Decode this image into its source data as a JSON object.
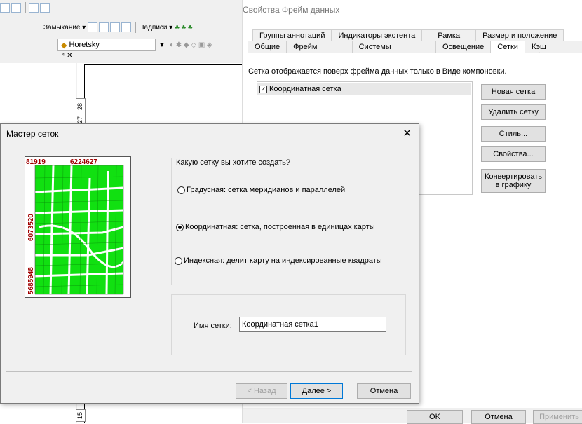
{
  "toolbar": {
    "snapping_label": "Замыкание ▾",
    "labels_label": "Надписи ▾",
    "layer_combo": "Horetsky",
    "pin_close": "⁴ ✕"
  },
  "rulers": {
    "r1": "28",
    "r2": "27",
    "r3": "15"
  },
  "props": {
    "title": "Свойства Фрейм данных",
    "tabs_top": [
      "Группы аннотаций",
      "Индикаторы экстента",
      "Рамка",
      "Размер и положение"
    ],
    "tabs_bottom": [
      "Общие",
      "Фрейм данных",
      "Системы координат",
      "Освещение",
      "Сетки",
      "Кэш объекта"
    ],
    "active_tab": "Сетки",
    "description": "Сетка отображается поверх фрейма данных только в Виде компоновки.",
    "grid_item": "Координатная сетка",
    "buttons": {
      "new": "Новая сетка",
      "delete": "Удалить сетку",
      "style": "Стиль...",
      "properties": "Свойства...",
      "convert": "Конвертировать в графику"
    },
    "footer": {
      "ok": "OK",
      "cancel": "Отмена",
      "apply": "Применить"
    }
  },
  "wizard": {
    "title": "Мастер сеток",
    "question": "Какую сетку вы хотите создать?",
    "options": [
      {
        "label": "Градусная: сетка меридианов и параллелей",
        "selected": false
      },
      {
        "label": "Координатная: сетка, построенная в единицах карты",
        "selected": true
      },
      {
        "label": "Индексная: делит карту на индексированные квадраты",
        "selected": false
      }
    ],
    "name_label": "Имя сетки:",
    "name_value": "Координатная сетка1",
    "preview": {
      "top_labels": [
        "81919",
        "6224627"
      ],
      "left_labels": [
        "6073520",
        "5685948"
      ]
    },
    "buttons": {
      "back": "< Назад",
      "next": "Далее >",
      "cancel": "Отмена"
    }
  },
  "colors": {
    "preview_fill": "#11e011",
    "preview_label": "#a00000",
    "accent": "#0078d7"
  }
}
